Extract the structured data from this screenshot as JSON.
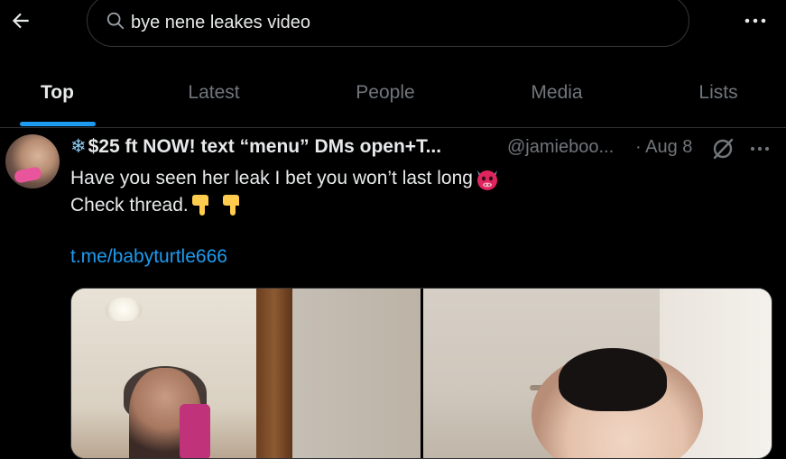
{
  "search": {
    "query": "bye nene leakes video"
  },
  "tabs": [
    {
      "label": "Top",
      "active": true
    },
    {
      "label": "Latest",
      "active": false
    },
    {
      "label": "People",
      "active": false
    },
    {
      "label": "Media",
      "active": false
    },
    {
      "label": "Lists",
      "active": false
    }
  ],
  "post": {
    "display_name": "$25 ft NOW! text “menu” DMs open+T...",
    "name_emoji": "❄",
    "handle": "@jamieboo...",
    "date": "· Aug 8",
    "text_line1": "Have you seen her leak I bet you won’t last long",
    "text_line2": "Check thread.",
    "link": "t.me/babyturtle666"
  },
  "icons": {
    "back": "arrow-left-icon",
    "search": "search-icon",
    "more": "more-horizontal-icon",
    "grok": "grok-icon",
    "devil_emoji": "devil-face-emoji",
    "pointing_down": "backhand-index-pointing-down-emoji"
  },
  "colors": {
    "background": "#000000",
    "text_primary": "#e7e9ea",
    "text_secondary": "#71767b",
    "accent": "#1d9bf0",
    "border": "#2f3336"
  }
}
